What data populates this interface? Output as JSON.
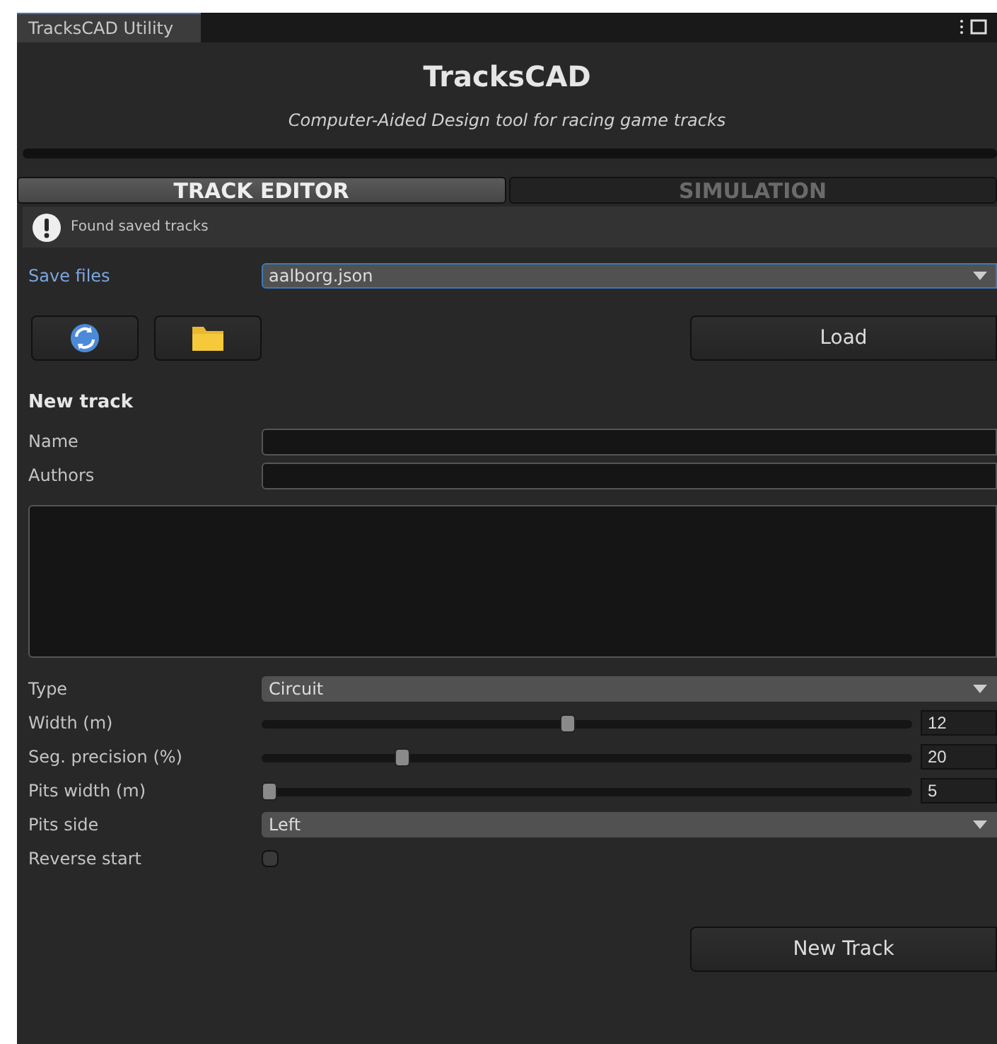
{
  "window": {
    "tab_title": "TracksCAD Utility"
  },
  "header": {
    "title": "TracksCAD",
    "subtitle": "Computer-Aided Design tool for racing game tracks"
  },
  "tabs": [
    {
      "label": "TRACK EDITOR",
      "selected": true
    },
    {
      "label": "SIMULATION",
      "selected": false
    }
  ],
  "help_box": {
    "message": "Found saved tracks"
  },
  "save_files": {
    "label": "Save files",
    "value": "aalborg.json"
  },
  "load_button": "Load",
  "new_track": {
    "heading": "New track",
    "fields": [
      {
        "label": "Name"
      },
      {
        "label": "Authors"
      }
    ],
    "settings": [
      {
        "kind": "dropdown",
        "label": "Type",
        "value": "Circuit"
      },
      {
        "kind": "slider",
        "label": "Width (m)",
        "level": 0.47,
        "value": "12"
      },
      {
        "kind": "slider",
        "label": "Seg. precision (%)",
        "level": 0.21,
        "value": "20"
      },
      {
        "kind": "slider",
        "label": "Pits width (m)",
        "level": 0,
        "value": "5"
      },
      {
        "kind": "dropdown",
        "label": "Pits side",
        "value": "Left"
      },
      {
        "kind": "checkbox",
        "label": "Reverse start",
        "checked": false
      }
    ],
    "button": "New Track"
  }
}
